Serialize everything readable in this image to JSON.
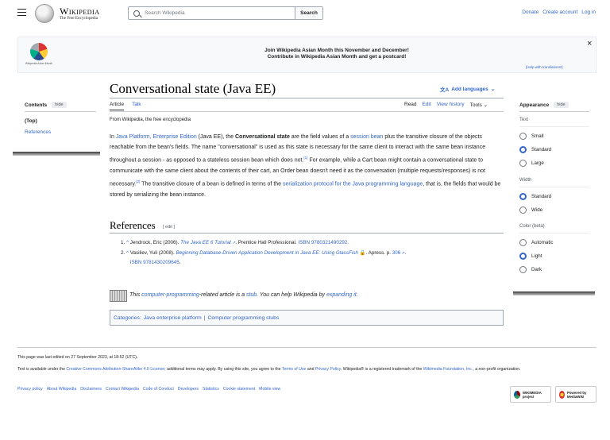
{
  "header": {
    "wordmark": "Wikipedia",
    "tagline": "The Free Encyclopedia",
    "search_placeholder": "Search Wikipedia",
    "search_button": "Search",
    "links": [
      "Donate",
      "Create account",
      "Log in"
    ]
  },
  "banner": {
    "logo_caption": "Wikipedia Asian Month",
    "line1": "Join Wikipedia Asian Month this November and December!",
    "line2": "Contribute in Wikipedia Asian Month and get a postcard!",
    "help": "[Help with translations!]",
    "close": "×"
  },
  "page": {
    "title": "Conversational state (Java EE)",
    "add_languages": "Add languages"
  },
  "toc": {
    "heading": "Contents",
    "hide": "hide",
    "items": [
      "(Top)",
      "References"
    ]
  },
  "tabs": {
    "left": [
      "Article",
      "Talk"
    ],
    "right": [
      "Read",
      "Edit",
      "View history",
      "Tools"
    ]
  },
  "article": {
    "from": "From Wikipedia, the free encyclopedia",
    "p": {
      "s1": "In ",
      "l1": "Java Platform, Enterprise Edition",
      "s2": " (Java EE), the ",
      "b1": "Conversational state",
      "s3": " are the field values of a ",
      "l2": "session bean",
      "s4": " plus the transitive closure of the objects reachable from the bean's fields. The name \"conversational\" is used as this state is necessary for the same client to interact with the same bean instance throughout a session - as opposed to a stateless session bean which does not.",
      "r1": "[1]",
      "s5": " For example, while a Cart bean might contain a conversational state to communicate with the same client about the contents of their cart, an Order bean doesn't need it as the conversation (multiple requests/responses) is not necessary.",
      "r2": "[2]",
      "s6": " The transitive closure of a bean is defined in terms of the ",
      "l3": "serialization protocol for the Java programming language",
      "s7": ", that is, the fields that would be stored by serializing the bean instance."
    },
    "references_heading": "References",
    "edit": "[ edit ]",
    "refs": [
      {
        "num": "1.",
        "caret": "^",
        "author": "Jendrock, Eric (2006).",
        "title": "The Java EE 6 Tutorial",
        "rest": ". Prentice Hall Professional.",
        "isbn_label": "ISBN",
        "isbn": "9780321490292",
        "end": "."
      },
      {
        "num": "2.",
        "caret": "^",
        "author": "Vasiliev, Yuli (2008).",
        "title": "Beginning Database-Driven Application Development in Java EE: Using GlassFish",
        "rest": ". Apress. p.",
        "page": "306",
        "isbn_label": "ISBN",
        "isbn": "9781430209645",
        "end": "."
      }
    ],
    "stub": {
      "s1": "This ",
      "l1": "computer-programming",
      "s2": "-related article is a ",
      "l2": "stub",
      "s3": ". You can help Wikipedia by ",
      "l3": "expanding it",
      "s4": "."
    },
    "categories_label": "Categories",
    "categories": [
      "Java enterprise platform",
      "Computer programming stubs"
    ]
  },
  "appearance": {
    "heading": "Appearance",
    "hide": "hide",
    "groups": [
      {
        "label": "Text",
        "options": [
          "Small",
          "Standard",
          "Large"
        ],
        "selected": "Standard"
      },
      {
        "label": "Width",
        "options": [
          "Standard",
          "Wide"
        ],
        "selected": "Standard"
      },
      {
        "label": "Color (beta)",
        "options": [
          "Automatic",
          "Light",
          "Dark"
        ],
        "selected": "Light"
      }
    ]
  },
  "footer": {
    "edited": "This page was last edited on 27 September 2023, at 18:52 (UTC).",
    "license": {
      "s1": "Text is available under the ",
      "l1": "Creative Commons Attribution-ShareAlike 4.0 License",
      "s2": "; additional terms may apply. By using this site, you agree to the ",
      "l2": "Terms of Use",
      "s3": " and ",
      "l3": "Privacy Policy",
      "s4": ". Wikipedia® is a registered trademark of the ",
      "l4": "Wikimedia Foundation, Inc.",
      "s5": ", a non-profit organization."
    },
    "links": [
      "Privacy policy",
      "About Wikipedia",
      "Disclaimers",
      "Contact Wikipedia",
      "Code of Conduct",
      "Developers",
      "Statistics",
      "Cookie statement",
      "Mobile view"
    ],
    "badge_wikimedia": "WIKIMEDIA project",
    "badge_mediawiki": "Powered by MediaWiki"
  }
}
